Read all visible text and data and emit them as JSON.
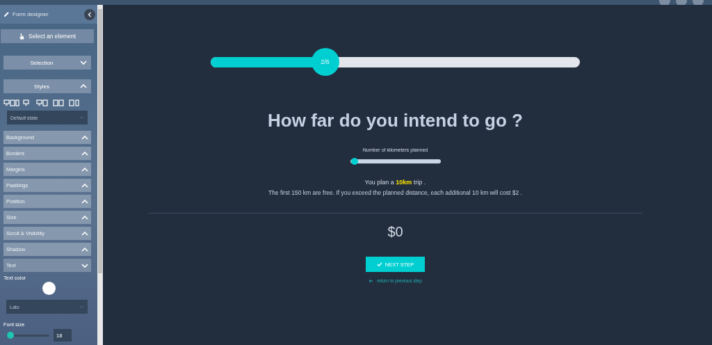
{
  "sidebar": {
    "title": "Form designer",
    "select_button": "Select an element",
    "panels": [
      {
        "label": "Selection",
        "expanded": false
      },
      {
        "label": "Styles",
        "expanded": true
      }
    ],
    "state_dropdown": {
      "value": "Default state"
    },
    "sections": [
      {
        "label": "Background",
        "expanded": false
      },
      {
        "label": "Borders",
        "expanded": false
      },
      {
        "label": "Margins",
        "expanded": false
      },
      {
        "label": "Paddings",
        "expanded": false
      },
      {
        "label": "Position",
        "expanded": false
      },
      {
        "label": "Size",
        "expanded": false
      },
      {
        "label": "Scroll & Visibility",
        "expanded": false
      },
      {
        "label": "Shadow",
        "expanded": false
      },
      {
        "label": "Text",
        "expanded": true
      }
    ],
    "text_color": {
      "label": "Text color",
      "color": "#ffffff"
    },
    "font_dropdown": {
      "value": "Lato"
    },
    "font_size": {
      "label": "Font size",
      "level": 0.1,
      "value": "18"
    }
  },
  "form": {
    "progress": {
      "label": "2/6",
      "level": 0.31
    },
    "title": "How far do you intend to go ?",
    "km_slider": {
      "label": "Number of kilometers planned",
      "level": 0.02
    },
    "summary": "You plan a **10km** trip .",
    "note": "The first 150 km are free. If you exceed the planned distance, each additional 10 km will cost $2 .",
    "price": "$0",
    "next_button": "NEXT STEP",
    "back_link": "return to previous step"
  }
}
